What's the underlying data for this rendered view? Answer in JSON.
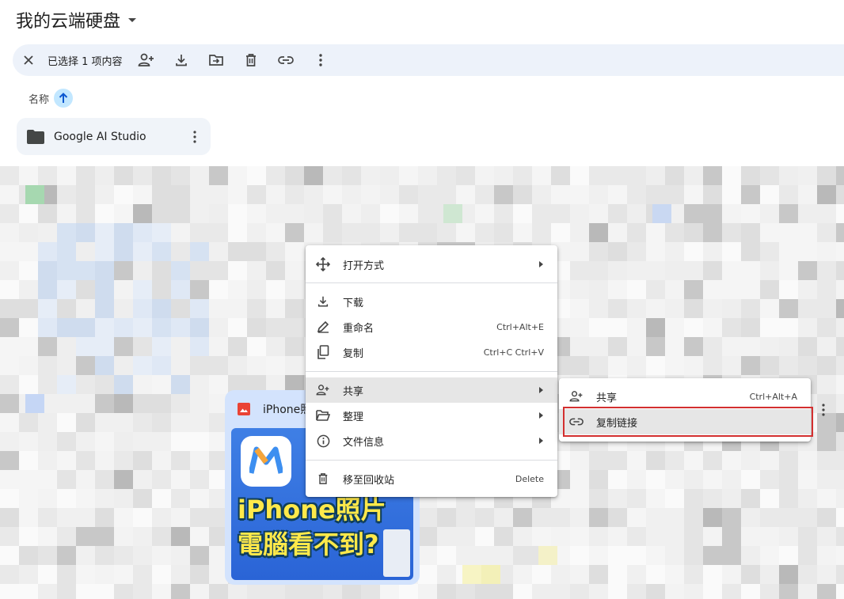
{
  "header": {
    "title": "我的云端硬盘"
  },
  "toolbar": {
    "selection_label": "已选择 1 项内容",
    "actions": [
      "close-icon",
      "share-person-icon",
      "download-icon",
      "move-to-folder-icon",
      "trash-icon",
      "link-icon",
      "more-vert-icon"
    ]
  },
  "sort": {
    "label": "名称",
    "direction": "ascending"
  },
  "folder": {
    "name": "Google AI Studio"
  },
  "file_card": {
    "name": "iPhone照",
    "thumbnail_text": [
      "iPhone照片",
      "電腦看不到?"
    ]
  },
  "context_menu": {
    "items": [
      {
        "label": "打开方式",
        "icon": "move-arrows-icon",
        "shortcut": "",
        "submenu": true
      },
      {
        "label": "下载",
        "icon": "download-icon",
        "shortcut": "",
        "submenu": false
      },
      {
        "label": "重命名",
        "icon": "pencil-icon",
        "shortcut": "Ctrl+Alt+E",
        "submenu": false
      },
      {
        "label": "复制",
        "icon": "copy-icon",
        "shortcut": "Ctrl+C Ctrl+V",
        "submenu": false
      },
      {
        "label": "共享",
        "icon": "share-person-icon",
        "shortcut": "",
        "submenu": true,
        "active": true
      },
      {
        "label": "整理",
        "icon": "folder-open-icon",
        "shortcut": "",
        "submenu": true
      },
      {
        "label": "文件信息",
        "icon": "info-icon",
        "shortcut": "",
        "submenu": true
      },
      {
        "label": "移至回收站",
        "icon": "trash-icon",
        "shortcut": "Delete",
        "submenu": false
      }
    ]
  },
  "submenu": {
    "items": [
      {
        "label": "共享",
        "icon": "share-person-icon",
        "shortcut": "Ctrl+Alt+A"
      },
      {
        "label": "复制链接",
        "icon": "link-icon",
        "shortcut": "",
        "highlighted": true
      }
    ]
  },
  "colors": {
    "toolbar_bg": "#edf2fa",
    "sort_bg": "#c2e7ff",
    "file_card_bg": "#d3e3fd",
    "highlight": "#d32f2f"
  }
}
